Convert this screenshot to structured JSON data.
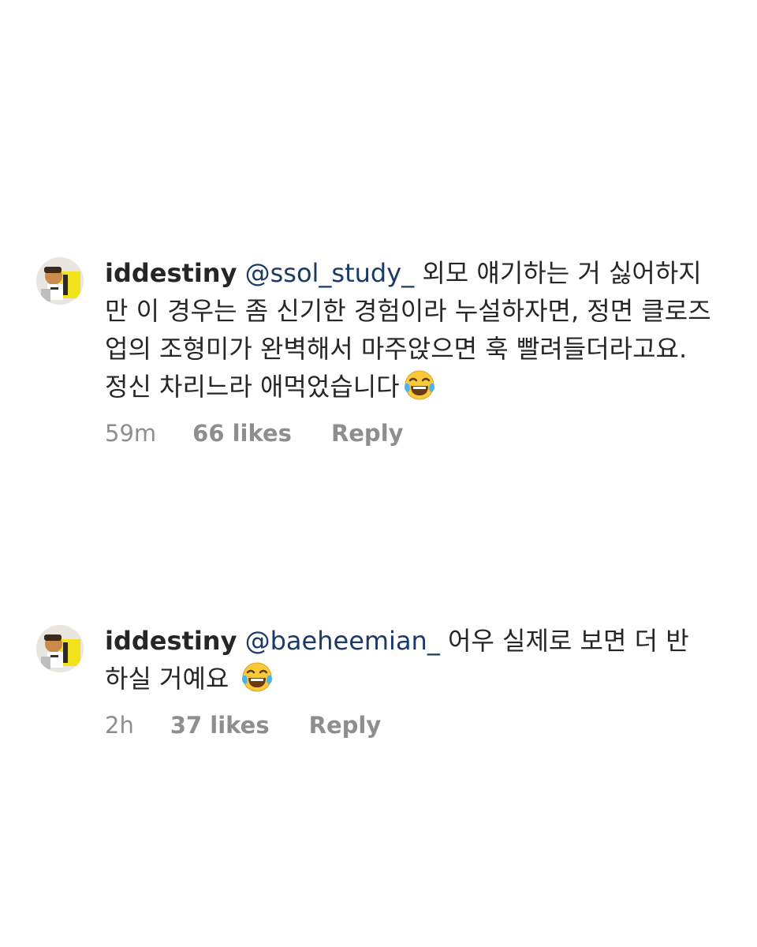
{
  "comments": [
    {
      "username": "iddestiny",
      "mention": "@ssol_study_",
      "text": "외모 얘기하는 거 싫어하지만 이 경우는 좀 신기한 경험이라 누설하자면, 정면 클로즈업의 조형미가 완벽해서 마주앉으면 훅 빨려들더라고요. 정신 차리느라 애먹었습니다",
      "emoji": "face-with-tears-of-joy-icon",
      "time": "59m",
      "likes": "66 likes",
      "reply": "Reply"
    },
    {
      "username": "iddestiny",
      "mention": "@baeheemian_",
      "text": "어우 실제로 보면 더 반하실 거예요",
      "emoji": "face-with-tears-of-joy-icon",
      "time": "2h",
      "likes": "37 likes",
      "reply": "Reply"
    }
  ],
  "colors": {
    "text": "#262626",
    "mention": "#1b3a67",
    "meta": "#8e8e8e",
    "background": "#ffffff"
  }
}
